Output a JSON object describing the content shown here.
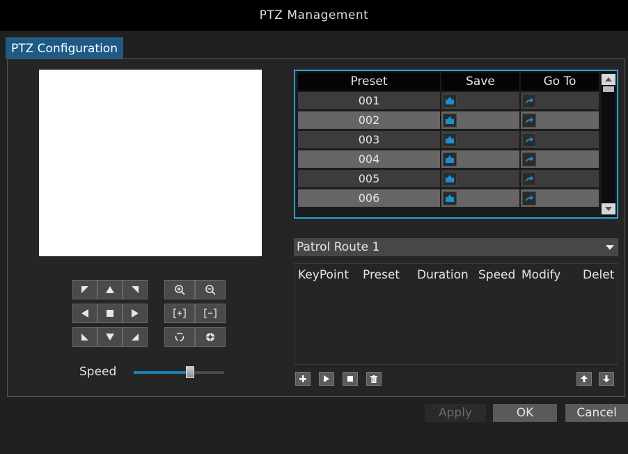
{
  "window": {
    "title": "PTZ Management"
  },
  "tabs": [
    {
      "label": "PTZ Configuration",
      "active": true
    }
  ],
  "ptz_controls": {
    "direction_buttons": [
      "up-left",
      "up",
      "up-right",
      "left",
      "stop",
      "right",
      "down-left",
      "down",
      "down-right"
    ],
    "lens_buttons": [
      "zoom-in",
      "zoom-out",
      "focus-near",
      "focus-far",
      "iris-close",
      "iris-open"
    ]
  },
  "speed": {
    "label": "Speed",
    "value_fraction": 0.62
  },
  "preset_table": {
    "columns": [
      "Preset",
      "Save",
      "Go To"
    ],
    "rows": [
      {
        "preset": "001"
      },
      {
        "preset": "002"
      },
      {
        "preset": "003"
      },
      {
        "preset": "004"
      },
      {
        "preset": "005"
      },
      {
        "preset": "006"
      }
    ]
  },
  "patrol": {
    "selected_route": "Patrol Route 1",
    "columns": [
      "KeyPoint",
      "Preset",
      "Duration",
      "Speed",
      "Modify",
      "Delet"
    ],
    "rows": []
  },
  "buttons": {
    "apply": "Apply",
    "ok": "OK",
    "cancel": "Cancel"
  },
  "colors": {
    "accent": "#2d9fd8",
    "tab_active": "#1d5a85",
    "icon_blue": "#1d8fd0"
  }
}
